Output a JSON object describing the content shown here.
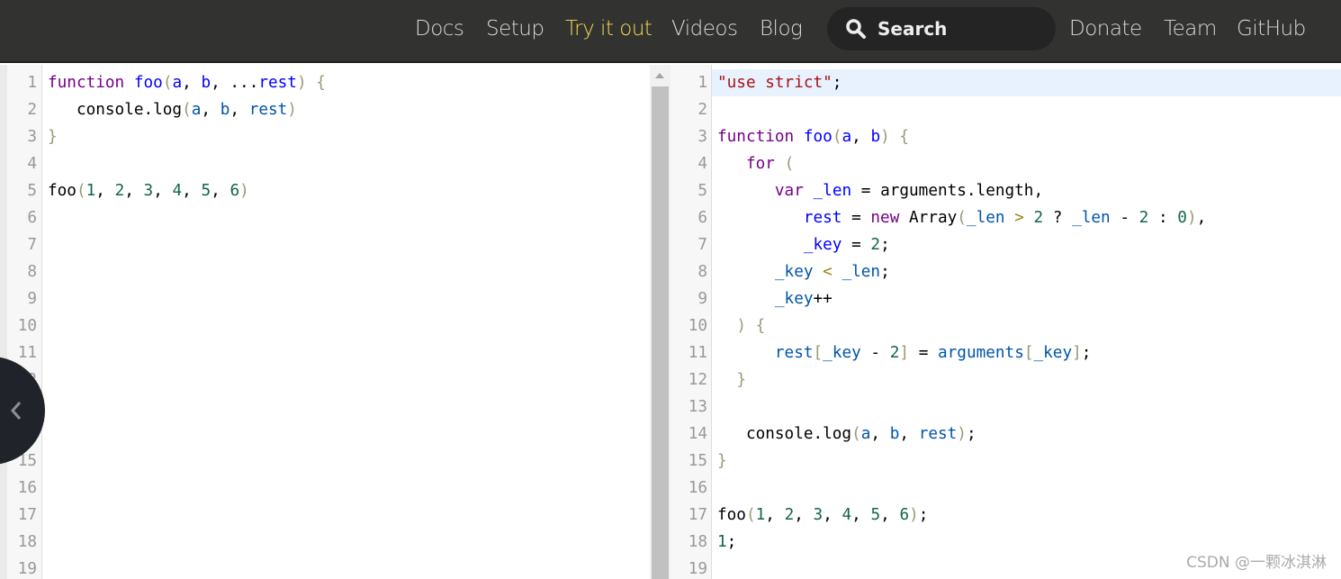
{
  "nav": {
    "items": [
      {
        "label": "Docs",
        "active": false
      },
      {
        "label": "Setup",
        "active": false
      },
      {
        "label": "Try it out",
        "active": true
      },
      {
        "label": "Videos",
        "active": false
      },
      {
        "label": "Blog",
        "active": false
      }
    ],
    "search": {
      "label": "Search",
      "icon": "search-icon"
    },
    "right_items": [
      {
        "label": "Donate"
      },
      {
        "label": "Team"
      },
      {
        "label": "GitHub"
      }
    ],
    "accent_color": "#f5da55"
  },
  "input_editor": {
    "line_count": 19,
    "lines": [
      [
        [
          "k",
          "function"
        ],
        [
          "p",
          " "
        ],
        [
          "d",
          "foo"
        ],
        [
          "b",
          "("
        ],
        [
          "d",
          "a"
        ],
        [
          "p",
          ", "
        ],
        [
          "d",
          "b"
        ],
        [
          "p",
          ", "
        ],
        [
          "p",
          "..."
        ],
        [
          "d",
          "rest"
        ],
        [
          "b",
          ")"
        ],
        [
          "p",
          " "
        ],
        [
          "b",
          "{"
        ]
      ],
      [
        [
          "p",
          "   console.log"
        ],
        [
          "b",
          "("
        ],
        [
          "v",
          "a"
        ],
        [
          "p",
          ", "
        ],
        [
          "v",
          "b"
        ],
        [
          "p",
          ", "
        ],
        [
          "v",
          "rest"
        ],
        [
          "b",
          ")"
        ]
      ],
      [
        [
          "b",
          "}"
        ]
      ],
      [],
      [
        [
          "p",
          "foo"
        ],
        [
          "b",
          "("
        ],
        [
          "n",
          "1"
        ],
        [
          "p",
          ", "
        ],
        [
          "n",
          "2"
        ],
        [
          "p",
          ", "
        ],
        [
          "n",
          "3"
        ],
        [
          "p",
          ", "
        ],
        [
          "n",
          "4"
        ],
        [
          "p",
          ", "
        ],
        [
          "n",
          "5"
        ],
        [
          "p",
          ", "
        ],
        [
          "n",
          "6"
        ],
        [
          "b",
          ")"
        ]
      ]
    ]
  },
  "output_editor": {
    "line_count": 19,
    "highlighted_line": 1,
    "lines": [
      [
        [
          "s",
          "\"use strict\""
        ],
        [
          "p",
          ";"
        ]
      ],
      [],
      [
        [
          "k",
          "function"
        ],
        [
          "p",
          " "
        ],
        [
          "d",
          "foo"
        ],
        [
          "b",
          "("
        ],
        [
          "d",
          "a"
        ],
        [
          "p",
          ", "
        ],
        [
          "d",
          "b"
        ],
        [
          "b",
          ")"
        ],
        [
          "p",
          " "
        ],
        [
          "b",
          "{"
        ]
      ],
      [
        [
          "p",
          "   "
        ],
        [
          "k",
          "for"
        ],
        [
          "p",
          " "
        ],
        [
          "b",
          "("
        ]
      ],
      [
        [
          "p",
          "      "
        ],
        [
          "k",
          "var"
        ],
        [
          "p",
          " "
        ],
        [
          "d",
          "_len"
        ],
        [
          "p",
          " = arguments.length,"
        ]
      ],
      [
        [
          "p",
          "         "
        ],
        [
          "d",
          "rest"
        ],
        [
          "p",
          " = "
        ],
        [
          "k",
          "new"
        ],
        [
          "p",
          " Array"
        ],
        [
          "b",
          "("
        ],
        [
          "v",
          "_len"
        ],
        [
          "p",
          " "
        ],
        [
          "o",
          ">"
        ],
        [
          "p",
          " "
        ],
        [
          "n",
          "2"
        ],
        [
          "p",
          " ? "
        ],
        [
          "v",
          "_len"
        ],
        [
          "p",
          " - "
        ],
        [
          "n",
          "2"
        ],
        [
          "p",
          " : "
        ],
        [
          "n",
          "0"
        ],
        [
          "b",
          ")"
        ],
        [
          "p",
          ","
        ]
      ],
      [
        [
          "p",
          "         "
        ],
        [
          "d",
          "_key"
        ],
        [
          "p",
          " = "
        ],
        [
          "n",
          "2"
        ],
        [
          "p",
          ";"
        ]
      ],
      [
        [
          "p",
          "      "
        ],
        [
          "v",
          "_key"
        ],
        [
          "p",
          " "
        ],
        [
          "o",
          "<"
        ],
        [
          "p",
          " "
        ],
        [
          "v",
          "_len"
        ],
        [
          "p",
          ";"
        ]
      ],
      [
        [
          "p",
          "      "
        ],
        [
          "v",
          "_key"
        ],
        [
          "p",
          "++"
        ]
      ],
      [
        [
          "p",
          "  "
        ],
        [
          "b",
          ")"
        ],
        [
          "p",
          " "
        ],
        [
          "b",
          "{"
        ]
      ],
      [
        [
          "p",
          "      "
        ],
        [
          "v",
          "rest"
        ],
        [
          "b",
          "["
        ],
        [
          "v",
          "_key"
        ],
        [
          "p",
          " - "
        ],
        [
          "n",
          "2"
        ],
        [
          "b",
          "]"
        ],
        [
          "p",
          " = "
        ],
        [
          "v",
          "arguments"
        ],
        [
          "b",
          "["
        ],
        [
          "v",
          "_key"
        ],
        [
          "b",
          "]"
        ],
        [
          "p",
          ";"
        ]
      ],
      [
        [
          "p",
          "  "
        ],
        [
          "b",
          "}"
        ]
      ],
      [],
      [
        [
          "p",
          "   console.log"
        ],
        [
          "b",
          "("
        ],
        [
          "v",
          "a"
        ],
        [
          "p",
          ", "
        ],
        [
          "v",
          "b"
        ],
        [
          "p",
          ", "
        ],
        [
          "v",
          "rest"
        ],
        [
          "b",
          ")"
        ],
        [
          "p",
          ";"
        ]
      ],
      [
        [
          "b",
          "}"
        ]
      ],
      [],
      [
        [
          "p",
          "foo"
        ],
        [
          "b",
          "("
        ],
        [
          "n",
          "1"
        ],
        [
          "p",
          ", "
        ],
        [
          "n",
          "2"
        ],
        [
          "p",
          ", "
        ],
        [
          "n",
          "3"
        ],
        [
          "p",
          ", "
        ],
        [
          "n",
          "4"
        ],
        [
          "p",
          ", "
        ],
        [
          "n",
          "5"
        ],
        [
          "p",
          ", "
        ],
        [
          "n",
          "6"
        ],
        [
          "b",
          ")"
        ],
        [
          "p",
          ";"
        ]
      ],
      [
        [
          "n",
          "1"
        ],
        [
          "p",
          ";"
        ]
      ],
      []
    ]
  },
  "sidebar_toggle": {
    "icon": "chevron-left-icon"
  },
  "watermark": "CSDN @一颗冰淇淋"
}
